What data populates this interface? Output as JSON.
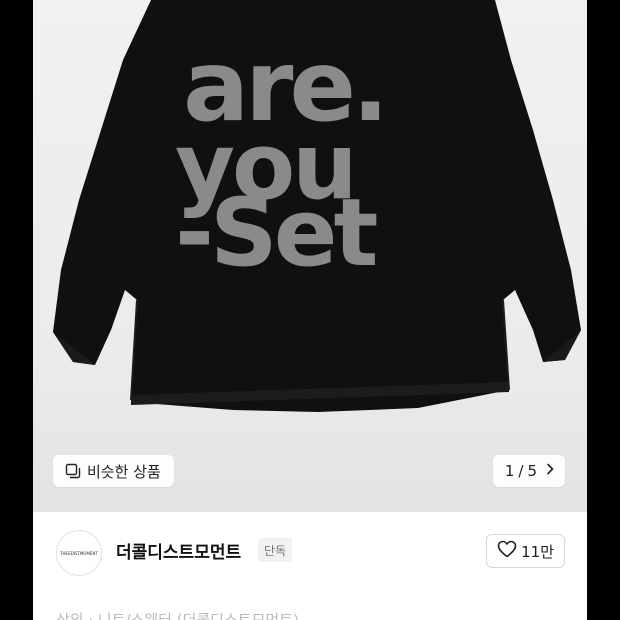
{
  "gallery": {
    "image_text": [
      "are.",
      "you",
      "-Set"
    ],
    "similar_label": "비슷한 상품",
    "similar_icon": "similar-items-icon",
    "pager": {
      "current": "1",
      "separator": "/",
      "total": "5"
    },
    "next_icon": "chevron-right-icon"
  },
  "seller": {
    "avatar_text": "THEEDISTMOMENT",
    "name": "더콜디스트모먼트",
    "badge": "단독",
    "like_icon": "heart-icon",
    "like_count": "11만"
  },
  "product": {
    "title_partial": "상의 · 니트/스웨터 (더콜디스트모먼트)"
  },
  "colors": {
    "sweater": "#101010",
    "print": "#8a8a8a",
    "background": "#000000"
  }
}
